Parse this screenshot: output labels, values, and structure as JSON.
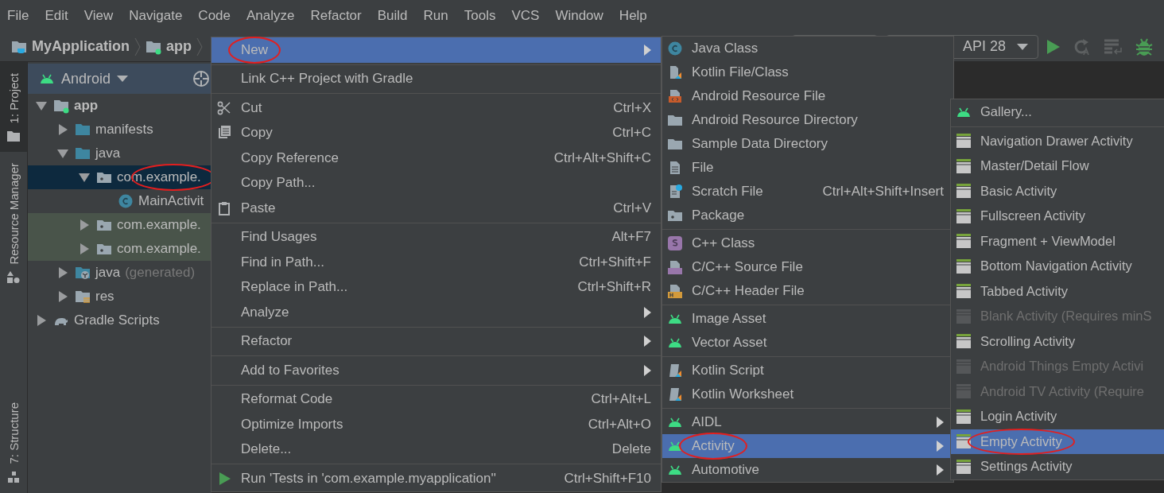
{
  "menu_bar": [
    {
      "label": "File"
    },
    {
      "label": "Edit"
    },
    {
      "label": "View"
    },
    {
      "label": "Navigate"
    },
    {
      "label": "Code"
    },
    {
      "label": "Analyze"
    },
    {
      "label": "Refactor"
    },
    {
      "label": "Build"
    },
    {
      "label": "Run"
    },
    {
      "label": "Tools"
    },
    {
      "label": "VCS"
    },
    {
      "label": "Window"
    },
    {
      "label": "Help"
    }
  ],
  "breadcrumb": [
    {
      "label": "MyApplication"
    },
    {
      "label": "app"
    }
  ],
  "toolbar": {
    "device_selector": "API 28"
  },
  "tool_window_tabs": [
    {
      "label": "1: Project",
      "selected": true
    },
    {
      "label": "Resource Manager",
      "selected": false
    },
    {
      "label": "7: Structure",
      "selected": false
    }
  ],
  "project_panel": {
    "view_selector": "Android",
    "tree": [
      {
        "label": "app",
        "expanded": true,
        "selected": false,
        "tinted": false,
        "circled": false,
        "children": [
          {
            "label": "manifests",
            "expanded": false,
            "selected": false,
            "tinted": false,
            "circled": false
          },
          {
            "label": "java",
            "expanded": true,
            "selected": false,
            "tinted": false,
            "circled": false,
            "children": [
              {
                "label": "com.example.",
                "expanded": true,
                "selected": true,
                "tinted": false,
                "circled": true,
                "children": [
                  {
                    "label": "MainActivit",
                    "selected": false,
                    "tinted": false,
                    "circled": false
                  }
                ]
              },
              {
                "label": "com.example.",
                "expanded": false,
                "selected": false,
                "tinted": true,
                "circled": false
              },
              {
                "label": "com.example.",
                "expanded": false,
                "selected": false,
                "tinted": true,
                "circled": false
              }
            ]
          },
          {
            "label": "java",
            "suffix": "(generated)",
            "expanded": false,
            "selected": false,
            "tinted": false,
            "circled": false
          },
          {
            "label": "res",
            "expanded": false,
            "selected": false,
            "tinted": false,
            "circled": false
          }
        ]
      },
      {
        "label": "Gradle Scripts",
        "expanded": false,
        "selected": false,
        "tinted": false,
        "circled": false
      }
    ]
  },
  "context_menu": {
    "groups": [
      [
        {
          "label": "New",
          "submenu": true,
          "selected": true,
          "circled": true
        }
      ],
      [
        {
          "label": "Link C++ Project with Gradle",
          "submenu": false,
          "selected": false,
          "circled": false
        }
      ],
      [
        {
          "label": "Cut",
          "shortcut": "Ctrl+X",
          "submenu": false,
          "selected": false,
          "circled": false
        },
        {
          "label": "Copy",
          "shortcut": "Ctrl+C",
          "submenu": false,
          "selected": false,
          "circled": false
        },
        {
          "label": "Copy Reference",
          "shortcut": "Ctrl+Alt+Shift+C",
          "submenu": false,
          "selected": false,
          "circled": false
        },
        {
          "label": "Copy Path...",
          "submenu": false,
          "selected": false,
          "circled": false
        },
        {
          "label": "Paste",
          "shortcut": "Ctrl+V",
          "submenu": false,
          "selected": false,
          "circled": false
        }
      ],
      [
        {
          "label": "Find Usages",
          "shortcut": "Alt+F7",
          "submenu": false,
          "selected": false,
          "circled": false
        },
        {
          "label": "Find in Path...",
          "shortcut": "Ctrl+Shift+F",
          "submenu": false,
          "selected": false,
          "circled": false
        },
        {
          "label": "Replace in Path...",
          "shortcut": "Ctrl+Shift+R",
          "submenu": false,
          "selected": false,
          "circled": false
        },
        {
          "label": "Analyze",
          "submenu": true,
          "selected": false,
          "circled": false
        }
      ],
      [
        {
          "label": "Refactor",
          "submenu": true,
          "selected": false,
          "circled": false
        }
      ],
      [
        {
          "label": "Add to Favorites",
          "submenu": true,
          "selected": false,
          "circled": false
        }
      ],
      [
        {
          "label": "Reformat Code",
          "shortcut": "Ctrl+Alt+L",
          "submenu": false,
          "selected": false,
          "circled": false
        },
        {
          "label": "Optimize Imports",
          "shortcut": "Ctrl+Alt+O",
          "submenu": false,
          "selected": false,
          "circled": false
        },
        {
          "label": "Delete...",
          "shortcut": "Delete",
          "submenu": false,
          "selected": false,
          "circled": false
        }
      ],
      [
        {
          "label": "Run 'Tests in 'com.example.myapplication''",
          "shortcut": "Ctrl+Shift+F10",
          "submenu": false,
          "selected": false,
          "circled": false
        }
      ]
    ]
  },
  "new_submenu": {
    "groups": [
      [
        {
          "label": "Java Class",
          "submenu": false,
          "selected": false,
          "circled": false
        },
        {
          "label": "Kotlin File/Class",
          "submenu": false,
          "selected": false,
          "circled": false
        },
        {
          "label": "Android Resource File",
          "submenu": false,
          "selected": false,
          "circled": false
        },
        {
          "label": "Android Resource Directory",
          "submenu": false,
          "selected": false,
          "circled": false
        },
        {
          "label": "Sample Data Directory",
          "submenu": false,
          "selected": false,
          "circled": false
        },
        {
          "label": "File",
          "submenu": false,
          "selected": false,
          "circled": false
        },
        {
          "label": "Scratch File",
          "shortcut": "Ctrl+Alt+Shift+Insert",
          "submenu": false,
          "selected": false,
          "circled": false
        },
        {
          "label": "Package",
          "submenu": false,
          "selected": false,
          "circled": false
        }
      ],
      [
        {
          "label": "C++ Class",
          "submenu": false,
          "selected": false,
          "circled": false
        },
        {
          "label": "C/C++ Source File",
          "submenu": false,
          "selected": false,
          "circled": false
        },
        {
          "label": "C/C++ Header File",
          "submenu": false,
          "selected": false,
          "circled": false
        }
      ],
      [
        {
          "label": "Image Asset",
          "submenu": false,
          "selected": false,
          "circled": false
        },
        {
          "label": "Vector Asset",
          "submenu": false,
          "selected": false,
          "circled": false
        }
      ],
      [
        {
          "label": "Kotlin Script",
          "submenu": false,
          "selected": false,
          "circled": false
        },
        {
          "label": "Kotlin Worksheet",
          "submenu": false,
          "selected": false,
          "circled": false
        }
      ],
      [
        {
          "label": "AIDL",
          "submenu": true,
          "selected": false,
          "circled": false
        },
        {
          "label": "Activity",
          "submenu": true,
          "selected": true,
          "circled": true
        },
        {
          "label": "Automotive",
          "submenu": true,
          "selected": false,
          "circled": false
        }
      ]
    ]
  },
  "activity_submenu": {
    "groups": [
      [
        {
          "label": "Gallery...",
          "disabled": false,
          "selected": false,
          "circled": false
        }
      ],
      [
        {
          "label": "Navigation Drawer Activity",
          "disabled": false,
          "selected": false,
          "circled": false
        },
        {
          "label": "Master/Detail Flow",
          "disabled": false,
          "selected": false,
          "circled": false
        },
        {
          "label": "Basic Activity",
          "disabled": false,
          "selected": false,
          "circled": false
        },
        {
          "label": "Fullscreen Activity",
          "disabled": false,
          "selected": false,
          "circled": false
        },
        {
          "label": "Fragment + ViewModel",
          "disabled": false,
          "selected": false,
          "circled": false
        },
        {
          "label": "Bottom Navigation Activity",
          "disabled": false,
          "selected": false,
          "circled": false
        },
        {
          "label": "Tabbed Activity",
          "disabled": false,
          "selected": false,
          "circled": false
        },
        {
          "label": "Blank Activity (Requires minS",
          "disabled": true,
          "selected": false,
          "circled": false
        },
        {
          "label": "Scrolling Activity",
          "disabled": false,
          "selected": false,
          "circled": false
        },
        {
          "label": "Android Things Empty Activi",
          "disabled": true,
          "selected": false,
          "circled": false
        },
        {
          "label": "Android TV Activity (Require",
          "disabled": true,
          "selected": false,
          "circled": false
        },
        {
          "label": "Login Activity",
          "disabled": false,
          "selected": false,
          "circled": false
        },
        {
          "label": "Empty Activity",
          "disabled": false,
          "selected": true,
          "circled": true
        },
        {
          "label": "Settings Activity",
          "disabled": false,
          "selected": false,
          "circled": false
        }
      ]
    ]
  }
}
